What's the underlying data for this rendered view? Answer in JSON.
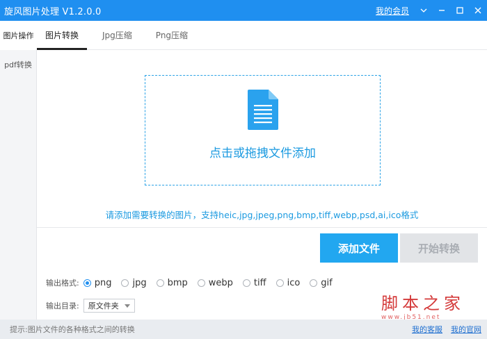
{
  "window": {
    "title": "旋风图片处理 V1.2.0.0",
    "vip_link": "我的会员",
    "controls": [
      "chevron-down-icon",
      "minimize-icon",
      "maximize-icon",
      "close-icon"
    ]
  },
  "sidebar": {
    "items": [
      {
        "label": "图片操作",
        "active": true
      },
      {
        "label": "pdf转换",
        "active": false
      }
    ]
  },
  "tabs": [
    {
      "label": "图片转换",
      "active": true
    },
    {
      "label": "Jpg压缩",
      "active": false
    },
    {
      "label": "Png压缩",
      "active": false
    }
  ],
  "dropzone": {
    "icon": "document-icon",
    "text": "点击或拖拽文件添加"
  },
  "hint_formats": "请添加需要转换的图片，支持heic,jpg,jpeg,png,bmp,tiff,webp,psd,ai,ico格式",
  "buttons": {
    "add": "添加文件",
    "start": "开始转换"
  },
  "output_format": {
    "label": "输出格式:",
    "options": [
      "png",
      "jpg",
      "bmp",
      "webp",
      "tiff",
      "ico",
      "gif"
    ],
    "selected": "png"
  },
  "output_dir": {
    "label": "输出目录:",
    "selected": "原文件夹"
  },
  "watermark": {
    "big": "脚本之家",
    "small": "www.jb51.net"
  },
  "statusbar": {
    "hint": "提示:图片文件的各种格式之间的转换",
    "links": [
      "我的客服",
      "我的官网"
    ]
  },
  "colors": {
    "titlebar": "#1f8ff0",
    "accent": "#22a7f0",
    "link": "#1b9ae0",
    "disabled": "#e2e4e7"
  }
}
